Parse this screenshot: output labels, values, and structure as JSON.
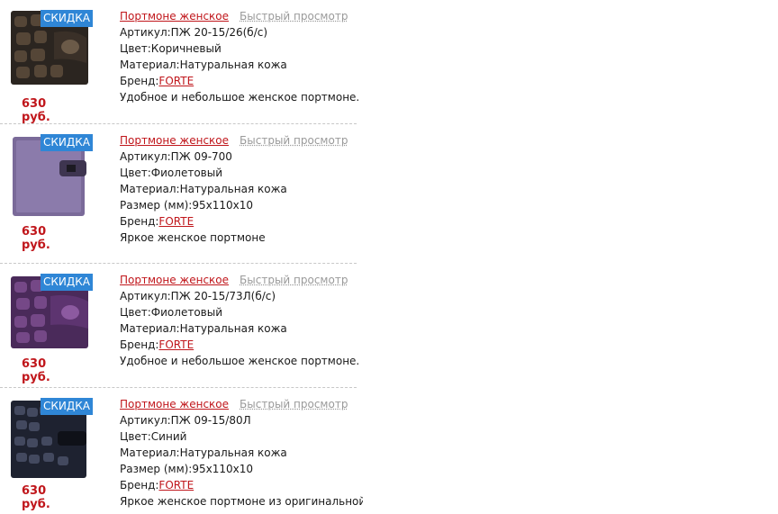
{
  "products": [
    {
      "badge": "СКИДКА",
      "price": "630 руб.",
      "title": "Портмоне женское",
      "quick_view": "Быстрый просмотр",
      "article": "Артикул:ПЖ 20-15/26(б/с)",
      "color": "Цвет:Коричневый",
      "material": "Материал:Натуральная кожа",
      "brand_label": "Бренд:",
      "brand": "FORTE",
      "description": "Удобное и небольшое женское портмоне."
    },
    {
      "badge": "СКИДКА",
      "price": "630 руб.",
      "title": "Портмоне женское",
      "quick_view": "Быстрый просмотр",
      "article": "Артикул:ПЖ 09-700",
      "color": "Цвет:Фиолетовый",
      "material": "Материал:Натуральная кожа",
      "size": "Размер (мм):95х110х10",
      "brand_label": "Бренд:",
      "brand": "FORTE",
      "description": "Яркое женское портмоне"
    },
    {
      "badge": "СКИДКА",
      "price": "630 руб.",
      "title": "Портмоне женское",
      "quick_view": "Быстрый просмотр",
      "article": "Артикул:ПЖ 20-15/73Л(б/с)",
      "color": "Цвет:Фиолетовый",
      "material": "Материал:Натуральная кожа",
      "brand_label": "Бренд:",
      "brand": "FORTE",
      "description": "Удобное и небольшое женское портмоне."
    },
    {
      "badge": "СКИДКА",
      "price": "630 руб.",
      "title": "Портмоне женское",
      "quick_view": "Быстрый просмотр",
      "article": "Артикул:ПЖ 09-15/80Л",
      "color": "Цвет:Синий",
      "material": "Материал:Натуральная кожа",
      "size": "Размер (мм):95х110х10",
      "brand_label": "Бренд:",
      "brand": "FORTE",
      "description": "Яркое женское портмоне из оригинальной кожи"
    }
  ],
  "colors": {
    "badge_bg": "#2f86d6",
    "price": "#c0161b",
    "link": "#c0161b",
    "quick_view": "#9a9a9a"
  }
}
